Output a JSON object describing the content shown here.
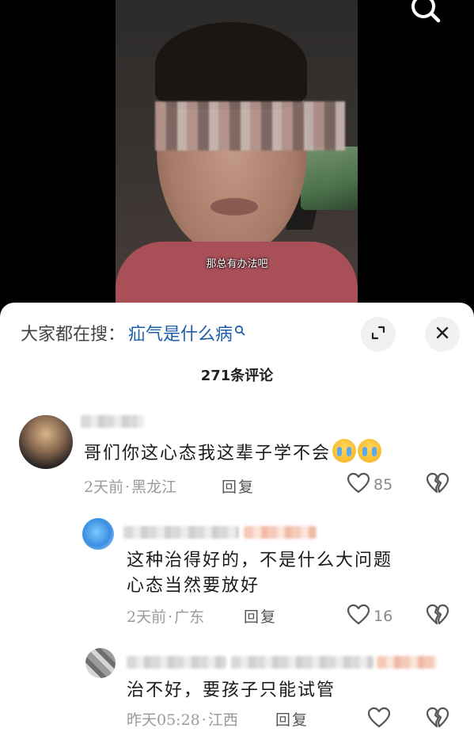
{
  "video": {
    "subtitle": "那总有办法吧"
  },
  "header": {
    "search_prefix": "大家都在搜：",
    "search_term": "疝气是什么病",
    "comment_count": "271条评论"
  },
  "comments": [
    {
      "text": "哥们你这心态我这辈子学不会",
      "emoji": [
        "crying-face",
        "crying-face"
      ],
      "time": "2天前",
      "location": "黑龙江",
      "reply_label": "回复",
      "likes": "85"
    },
    {
      "text_line1": "这种治得好的，不是什么大问题",
      "text_line2": "心态当然要放好",
      "time": "2天前",
      "location": "广东",
      "reply_label": "回复",
      "likes": "16"
    },
    {
      "text": "治不好，要孩子只能试管",
      "time": "昨天05:28",
      "location": "江西",
      "reply_label": "回复",
      "likes": ""
    }
  ],
  "colors": {
    "search_term": "#1e5ea8",
    "meta": "#9a9a9a",
    "sheet_bg": "#ffffff"
  },
  "icons": {
    "top_right": "search-icon",
    "expand": "expand-icon",
    "close": "close-icon",
    "like": "heart-outline-icon",
    "dislike": "broken-heart-icon"
  }
}
